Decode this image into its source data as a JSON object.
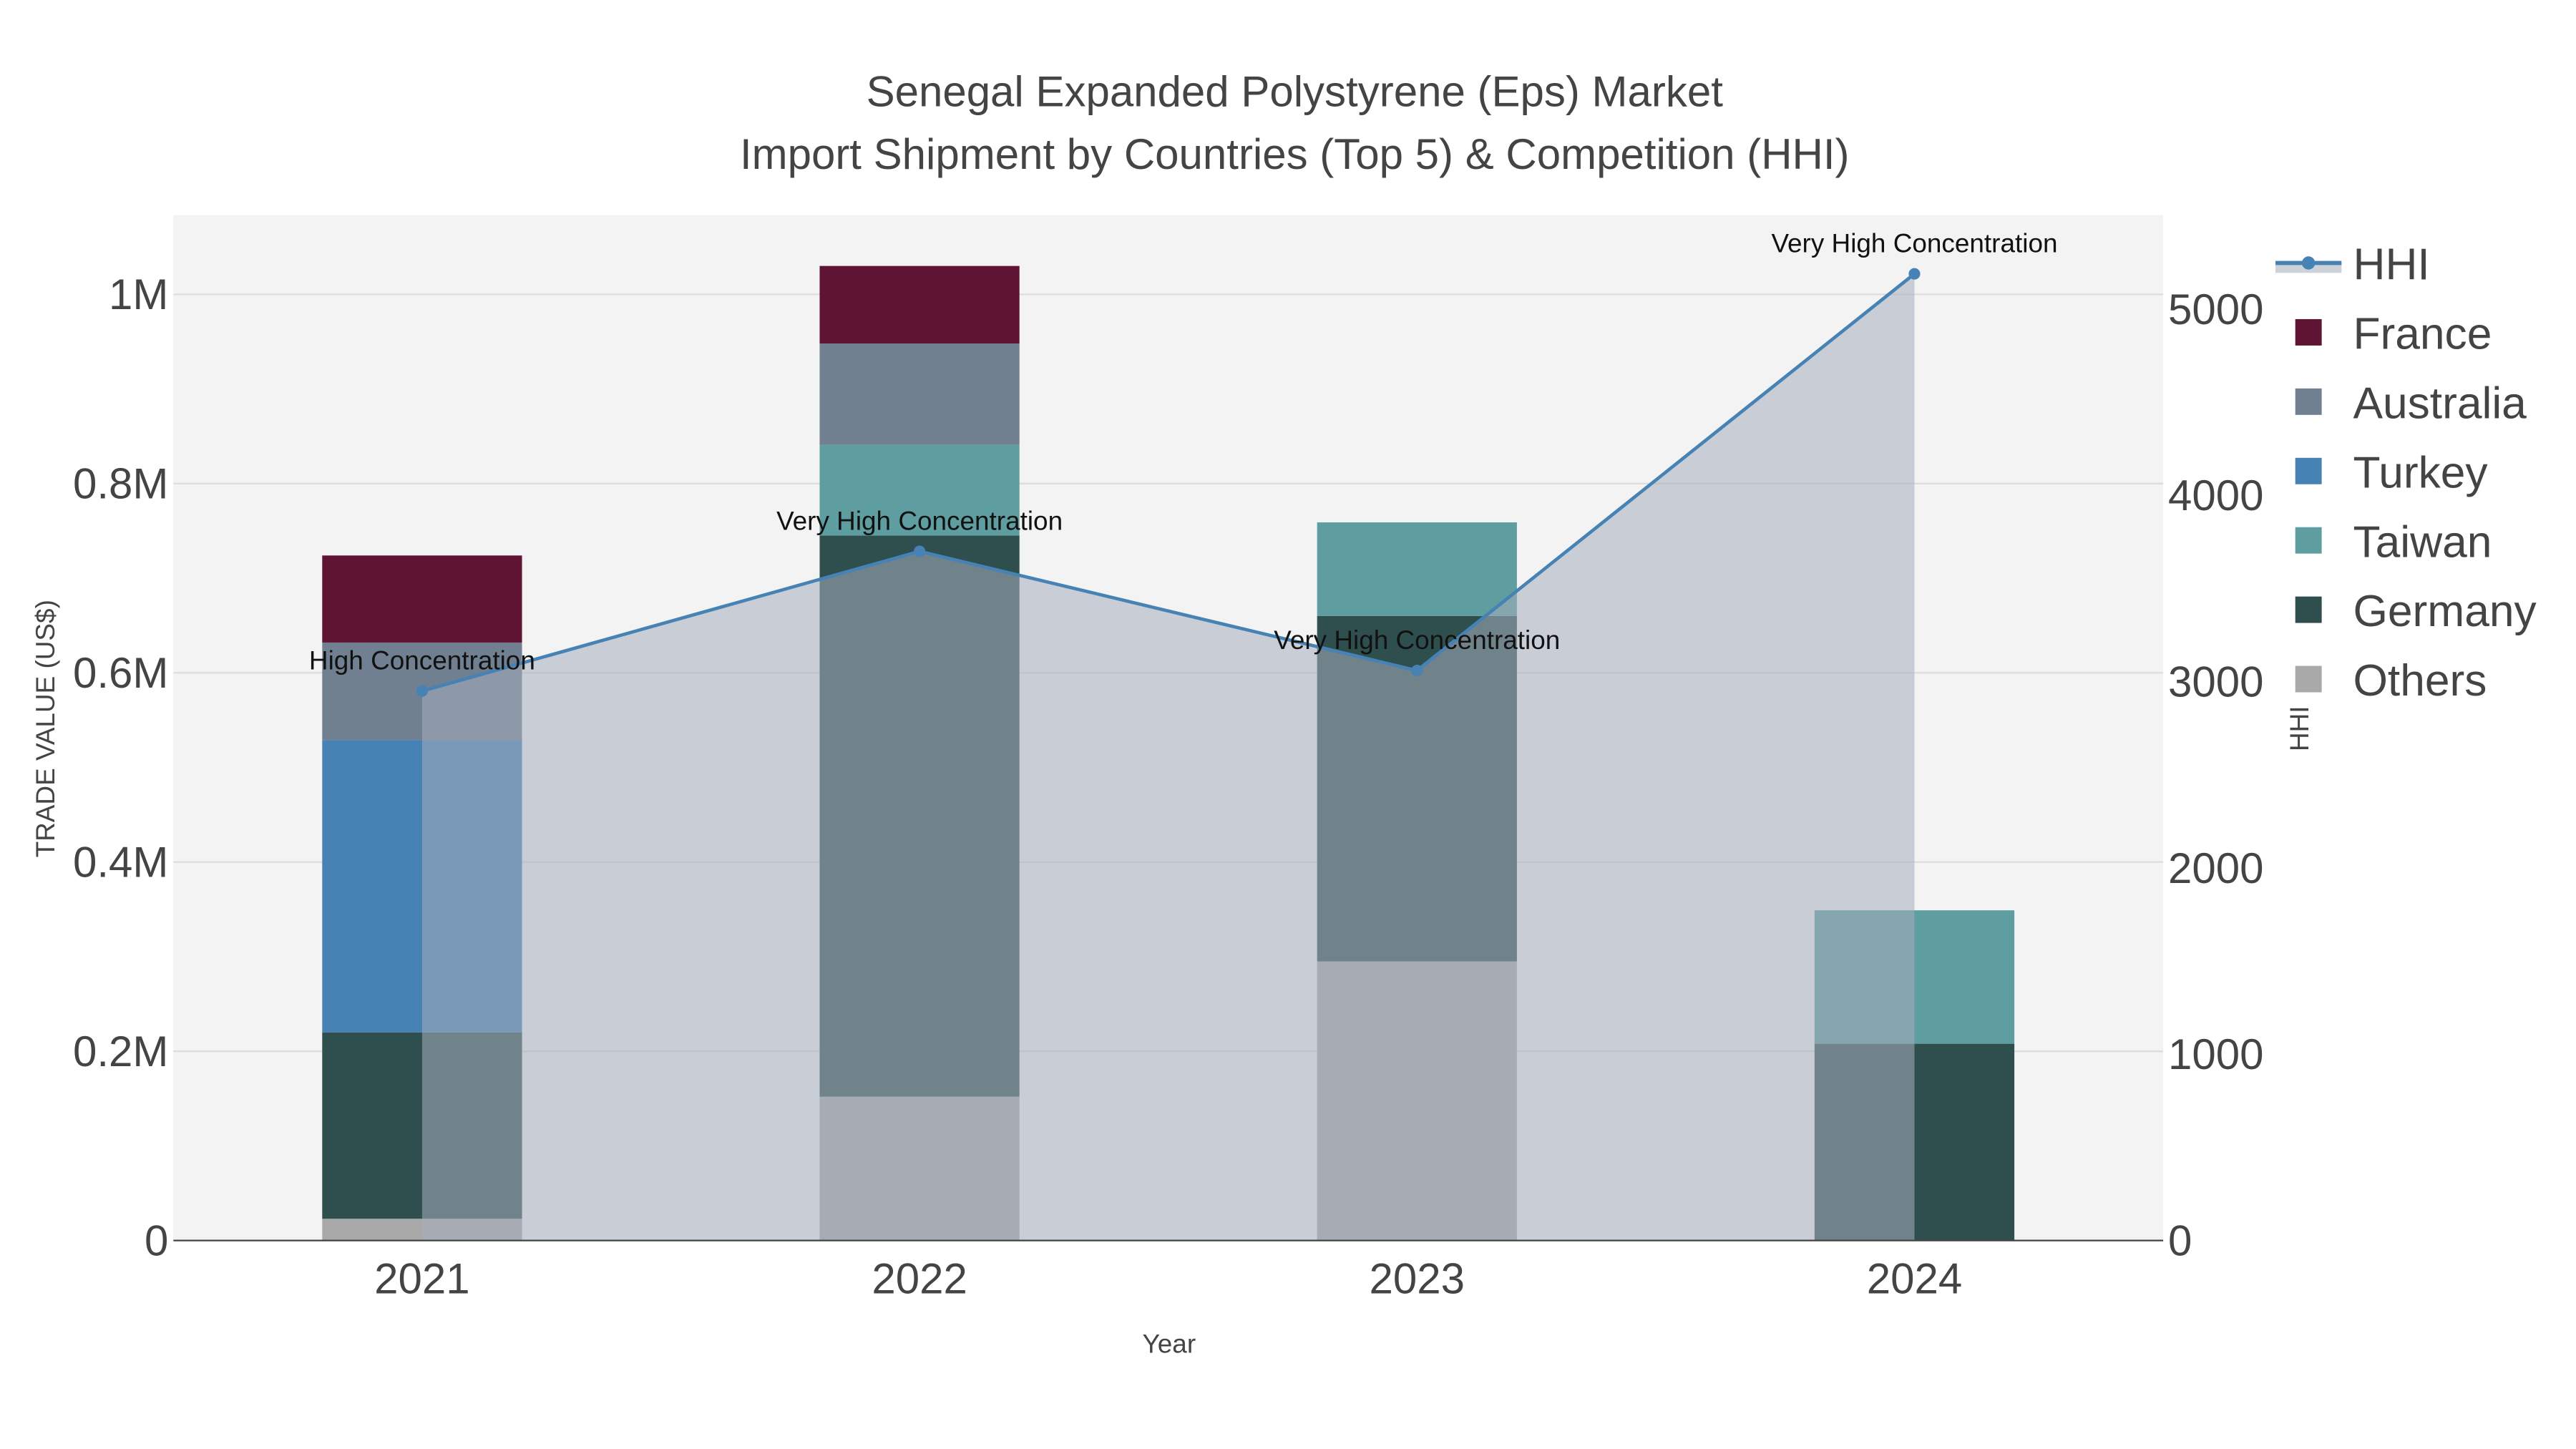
{
  "chart_data": {
    "type": "bar",
    "title_line1": "Senegal Expanded Polystyrene (Eps) Market",
    "title_line2": "Import Shipment by Countries (Top 5) & Competition (HHI)",
    "xlabel": "Year",
    "ylabel": "TRADE VALUE (US$)",
    "y2label": "HHI",
    "categories": [
      "2021",
      "2022",
      "2023",
      "2024"
    ],
    "ylim": [
      0,
      1080000
    ],
    "y2lim": [
      0,
      5500
    ],
    "yticks": [
      {
        "v": 0,
        "label": "0"
      },
      {
        "v": 200000,
        "label": "0.2M"
      },
      {
        "v": 400000,
        "label": "0.4M"
      },
      {
        "v": 600000,
        "label": "0.6M"
      },
      {
        "v": 800000,
        "label": "0.8M"
      },
      {
        "v": 1000000,
        "label": "1M"
      }
    ],
    "y2ticks": [
      {
        "v": 0,
        "label": "0"
      },
      {
        "v": 1000,
        "label": "1000"
      },
      {
        "v": 2000,
        "label": "2000"
      },
      {
        "v": 3000,
        "label": "3000"
      },
      {
        "v": 4000,
        "label": "4000"
      },
      {
        "v": 5000,
        "label": "5000"
      }
    ],
    "series": [
      {
        "name": "Others",
        "color": "#a9a9a9",
        "values": [
          23000,
          152000,
          295000,
          0
        ]
      },
      {
        "name": "Germany",
        "color": "#2f4f4f",
        "values": [
          197000,
          593000,
          365000,
          208000
        ]
      },
      {
        "name": "Taiwan",
        "color": "#5f9ea0",
        "values": [
          0,
          96000,
          99000,
          141000
        ]
      },
      {
        "name": "Turkey",
        "color": "#4682b4",
        "values": [
          309000,
          0,
          0,
          0
        ]
      },
      {
        "name": "Australia",
        "color": "#708090",
        "values": [
          103000,
          107000,
          0,
          0
        ]
      },
      {
        "name": "France",
        "color": "#5f1433",
        "values": [
          92000,
          82000,
          0,
          0
        ]
      }
    ],
    "hhi": {
      "name": "HHI",
      "color": "#4682b4",
      "values": [
        2950,
        3700,
        3060,
        5190
      ],
      "annotations": [
        "High Concentration",
        "Very High Concentration",
        "Very High Concentration",
        "Very High Concentration"
      ]
    },
    "legend": [
      "HHI",
      "France",
      "Australia",
      "Turkey",
      "Taiwan",
      "Germany",
      "Others"
    ],
    "legend_placement": "right",
    "grid": true
  }
}
